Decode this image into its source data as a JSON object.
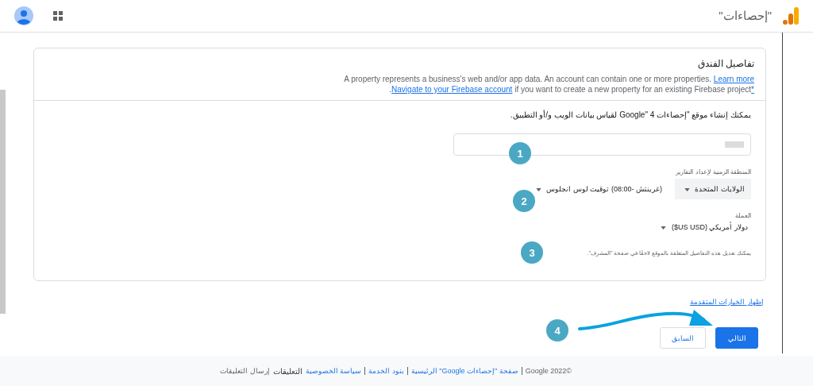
{
  "app_bar": {
    "title": "\"إحصاءات\""
  },
  "card": {
    "title": "تفاصيل الفندق",
    "description": "A property represents a business's web and/or app data. An account can contain one or more properties.",
    "learn_more": "Learn more",
    "firebase_link": "Navigate to your Firebase account",
    "firebase_text": "if you want to create a new property for an existing Firebase project",
    "footnote": "*",
    "period": ".",
    "intro": "يمكنك إنشاء موقع \"إحصاءات Google\" 4 لقياس بيانات الويب و/أو التطبيق.",
    "timezone_label": "المنطقة الزمنية لإعداد التقارير",
    "country": "الولايات المتحدة",
    "timezone": "(غرينتش -08:00) توقيت لوس انجلوس",
    "currency_label": "العملة",
    "currency": "دولار أمريكي (US USD$)",
    "note": "يمكنك تعديل هذه التفاصيل المتعلقة بالموقع لاحقًا في صفحة \"المشرف\"."
  },
  "advanced_link": "إظهار الخيارات المتقدمة",
  "buttons": [
    {
      "label": "التالي",
      "kind": "primary"
    },
    {
      "label": "السابق",
      "kind": "secondary"
    }
  ],
  "markers": [
    "1",
    "2",
    "3",
    "4"
  ],
  "footer": {
    "copyright": "©2022 Google",
    "links": [
      "صفحة \"إحصاءات Google\" الرئيسية",
      "بنود الخدمة",
      "سياسة الخصوصية"
    ],
    "feedback_label": "التعليقات",
    "feedback": "إرسال التعليقات"
  }
}
